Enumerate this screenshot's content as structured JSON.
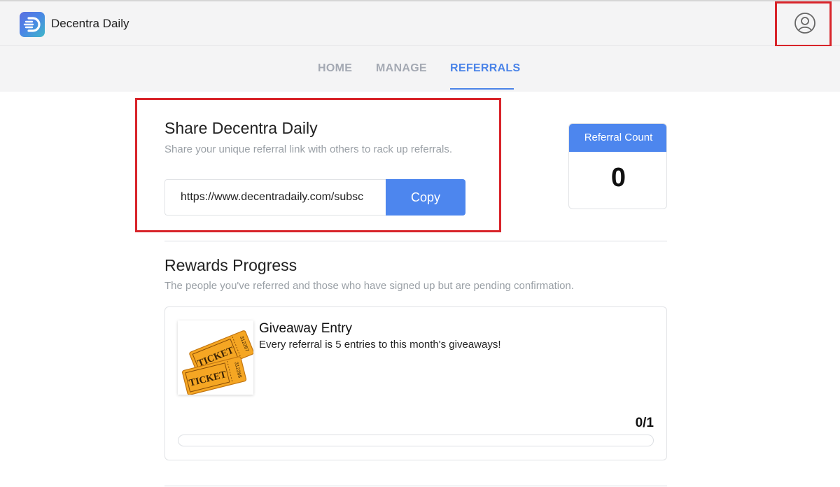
{
  "header": {
    "brand": "Decentra Daily",
    "logo_icon": "decentra-logo-icon",
    "account_icon": "user-circle-icon"
  },
  "nav": {
    "tabs": [
      {
        "label": "HOME",
        "active": false
      },
      {
        "label": "MANAGE",
        "active": false
      },
      {
        "label": "REFERRALS",
        "active": true
      }
    ]
  },
  "share": {
    "title": "Share Decentra Daily",
    "subtitle": "Share your unique referral link with others to rack up referrals.",
    "link_value": "https://www.decentradaily.com/subsc",
    "copy_label": "Copy"
  },
  "referral_card": {
    "label": "Referral Count",
    "count": "0"
  },
  "rewards": {
    "title": "Rewards Progress",
    "subtitle": "The people you've referred and those who have signed up but are pending confirmation.",
    "items": [
      {
        "name": "Giveaway Entry",
        "description": "Every referral is 5 entries to this month's giveaways!",
        "progress_text": "0/1",
        "progress_fraction": 0,
        "image_icon": "ticket-icon",
        "ticket_text": "TICKET",
        "ticket_numbers": [
          "312267",
          "312268"
        ]
      }
    ]
  },
  "colors": {
    "accent": "#4d86ee",
    "highlight": "#d8242a",
    "ticket": "#f5a623"
  }
}
